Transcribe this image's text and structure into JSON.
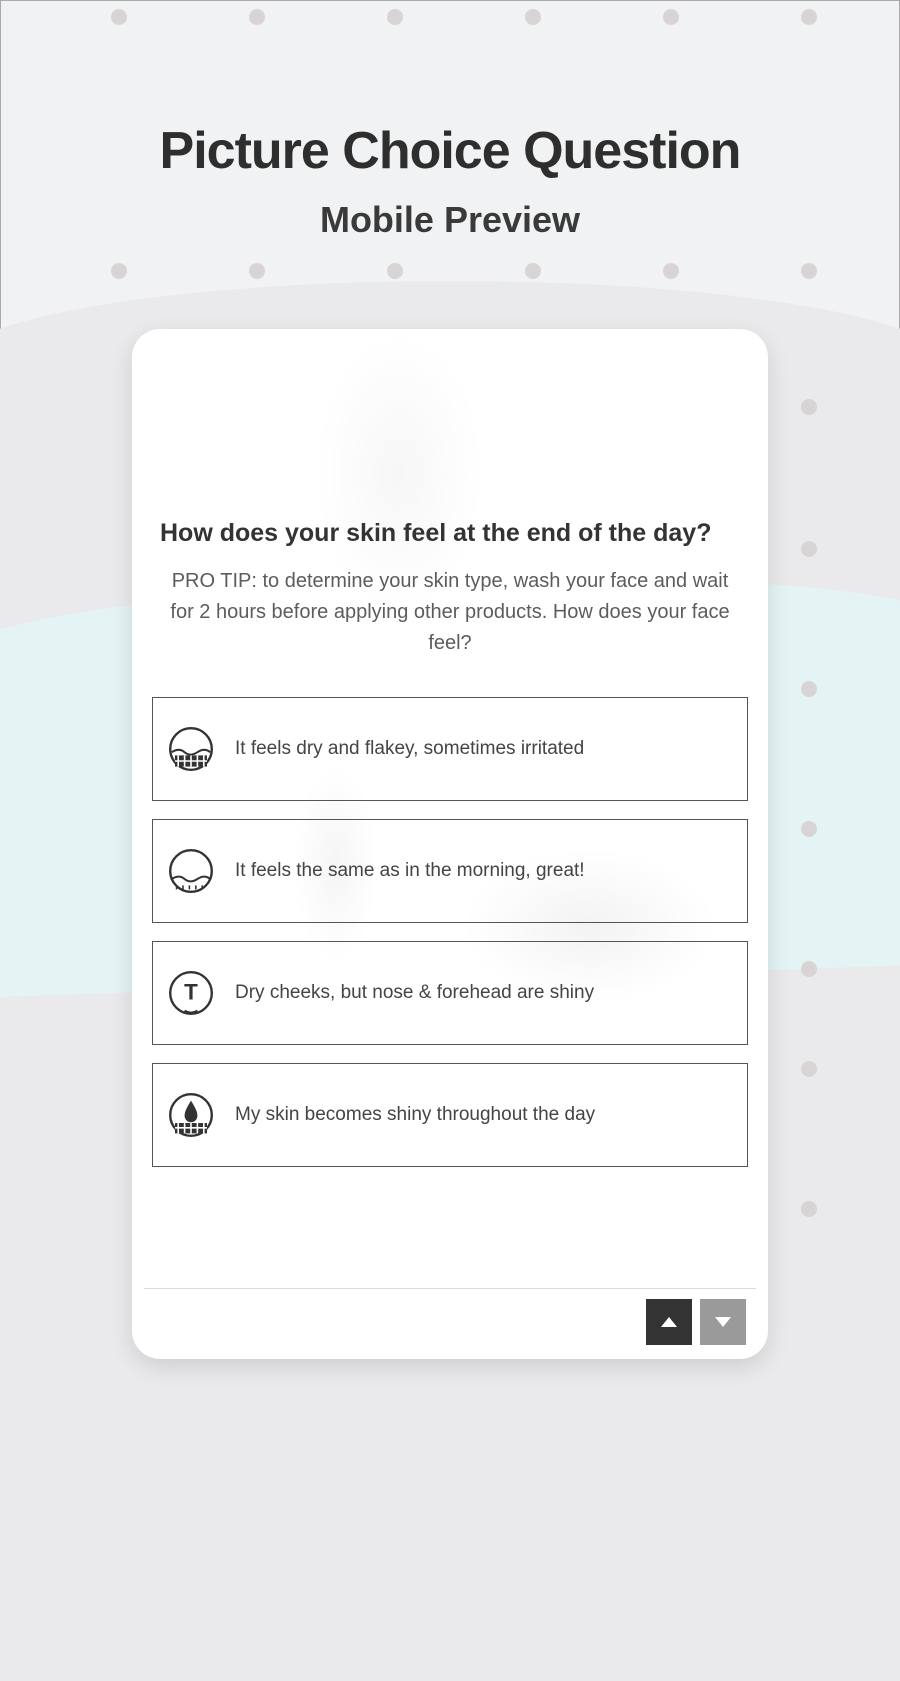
{
  "page": {
    "title": "Picture Choice Question",
    "subtitle": "Mobile Preview"
  },
  "question": {
    "title": "How does your skin feel at the end of the day?",
    "tip": "PRO TIP: to determine your skin type, wash your face and wait for 2 hours before applying other products. How does your face feel?"
  },
  "options": [
    {
      "icon": "dry-skin-icon",
      "label": "It feels dry and flakey, sometimes irritated"
    },
    {
      "icon": "normal-skin-icon",
      "label": "It feels the same as in the morning, great!"
    },
    {
      "icon": "tzone-skin-icon",
      "label": "Dry cheeks, but nose & forehead are shiny"
    },
    {
      "icon": "oily-skin-icon",
      "label": "My skin becomes shiny throughout the day"
    }
  ],
  "nav": {
    "up_label": "Previous",
    "down_label": "Next"
  }
}
